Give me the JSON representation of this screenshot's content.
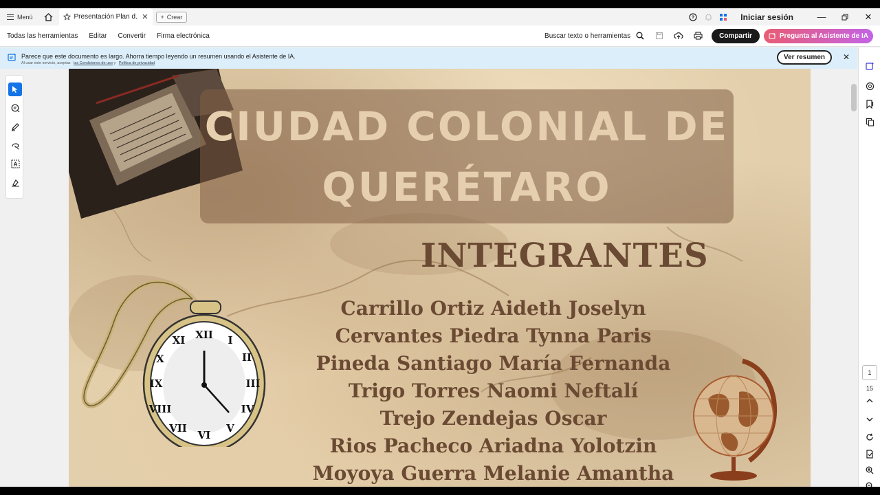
{
  "titlebar": {
    "menu_label": "Menú",
    "tab_title": "Presentación Plan d...",
    "create_label": "Crear",
    "signin_label": "Iniciar sesión"
  },
  "toolbar": {
    "items": [
      "Todas las herramientas",
      "Editar",
      "Convertir",
      "Firma electrónica"
    ],
    "search_label": "Buscar texto o herramientas",
    "share_label": "Compartir",
    "ai_label": "Pregunta al Asistente de IA"
  },
  "banner": {
    "message": "Parece que este documento es largo. Ahorra tiempo leyendo un resumen usando el Asistente de IA.",
    "sub_prefix": "Al usar este servicio, aceptas",
    "terms_link": "las Condiciones de uso",
    "sub_and": "y",
    "privacy_link": "Política de privacidad",
    "button_label": "Ver resumen"
  },
  "pager": {
    "current_page": "1",
    "total_pages": "15"
  },
  "document": {
    "title_line1": "CIUDAD COLONIAL DE",
    "title_line2": "QUERÉTARO",
    "section_heading": "INTEGRANTES",
    "members": [
      "Carrillo Ortiz Aideth Joselyn",
      "Cervantes Piedra Tynna Paris",
      "Pineda Santiago María Fernanda",
      "Trigo Torres Naomi Neftalí",
      "Trejo Zendejas Oscar",
      "Rios Pacheco Ariadna Yolotzin",
      "Moyoya Guerra Melanie Amantha"
    ]
  },
  "colors": {
    "accent_blue": "#1473e6",
    "banner_bg": "#dbeefa",
    "share_bg": "#1a1a1a",
    "title_color": "#e6cfae",
    "heading_color": "#6b4a33"
  }
}
